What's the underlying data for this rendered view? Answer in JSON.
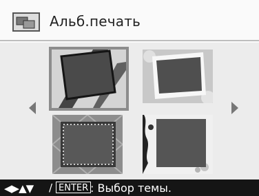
{
  "header": {
    "title": "Альб.печать",
    "icon": "album-print-icon"
  },
  "themes": [
    {
      "id": "theme-1",
      "selected": true
    },
    {
      "id": "theme-2",
      "selected": false
    },
    {
      "id": "theme-3",
      "selected": false
    },
    {
      "id": "theme-4",
      "selected": false
    }
  ],
  "footer": {
    "nav_arrows": "◀▶▲▼",
    "slash": "/",
    "enter_key": "ENTER",
    "hint": ": Выбор темы."
  },
  "colors": {
    "selection_border": "#8c8c8c",
    "footer_bg": "#151515",
    "photo_placeholder": "#555555"
  }
}
